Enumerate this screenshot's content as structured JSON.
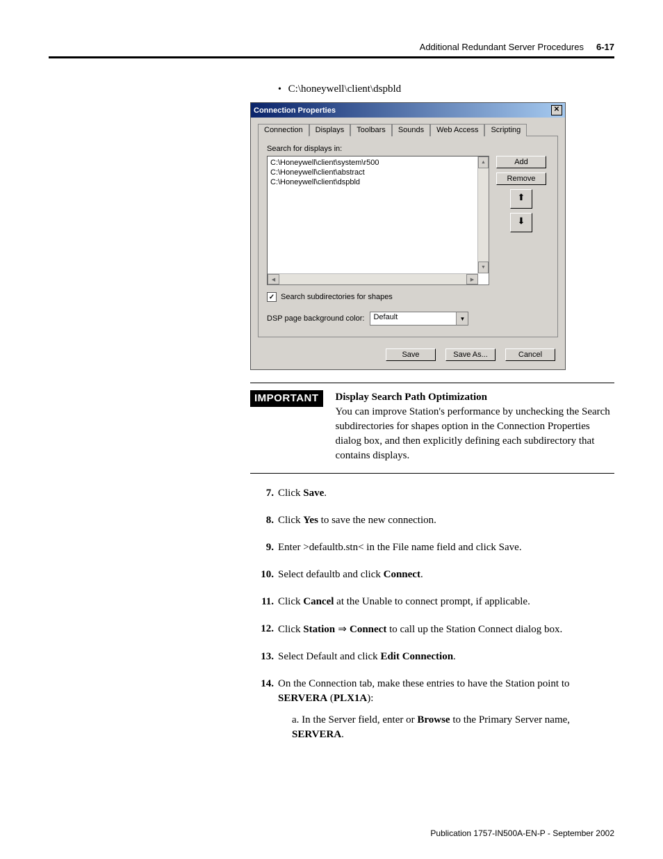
{
  "header": {
    "title": "Additional Redundant Server Procedures",
    "page_num": "6-17"
  },
  "bullet_path": "C:\\honeywell\\client\\dspbld",
  "dialog": {
    "title": "Connection Properties",
    "close_glyph": "✕",
    "tabs": [
      "Connection",
      "Displays",
      "Toolbars",
      "Sounds",
      "Web Access",
      "Scripting"
    ],
    "active_tab": 1,
    "search_label": "Search for displays in:",
    "paths": [
      "C:\\Honeywell\\client\\system\\r500",
      "C:\\Honeywell\\client\\abstract",
      "C:\\Honeywell\\client\\dspbld"
    ],
    "buttons": {
      "add": "Add",
      "remove": "Remove",
      "up": "⬆",
      "down": "⬇"
    },
    "checkbox_label": "Search subdirectories for shapes",
    "checkbox_checked": true,
    "bg_label": "DSP page background color:",
    "bg_value": "Default",
    "footer": {
      "save": "Save",
      "saveas": "Save As...",
      "cancel": "Cancel"
    }
  },
  "important": {
    "badge": "IMPORTANT",
    "title": "Display Search Path Optimization",
    "body": "You can improve Station's performance by unchecking the Search subdirectories for shapes option in the Connection Properties dialog box, and then explicitly defining each subdirectory that contains displays."
  },
  "steps": {
    "s7a": "Click ",
    "s7b": "Save",
    "s7c": ".",
    "s8a": "Click ",
    "s8b": "Yes",
    "s8c": " to save the new connection.",
    "s9": "Enter >defaultb.stn< in the File name field and click Save.",
    "s10a": "Select defaultb and click ",
    "s10b": "Connect",
    "s10c": ".",
    "s11a": "Click ",
    "s11b": "Cancel",
    "s11c": " at the Unable to connect prompt, if applicable.",
    "s12a": "Click ",
    "s12b": "Station",
    "s12c": " ⇒ ",
    "s12d": "Connect",
    "s12e": " to call up the Station Connect dialog box.",
    "s13a": "Select Default and click ",
    "s13b": "Edit Connection",
    "s13c": ".",
    "s14a": "On the Connection tab, make these entries to have the Station point to ",
    "s14b": "SERVERA",
    "s14c": " (",
    "s14d": "PLX1A",
    "s14e": "):",
    "s14sub_a": "In the Server field, enter or ",
    "s14sub_b": "Browse",
    "s14sub_c": " to the Primary Server name, ",
    "s14sub_d": "SERVERA",
    "s14sub_e": "."
  },
  "nums": {
    "n7": "7.",
    "n8": "8.",
    "n9": "9.",
    "n10": "10.",
    "n11": "11.",
    "n12": "12.",
    "n13": "13.",
    "n14": "14.",
    "sa": "a."
  },
  "footer_pub": "Publication 1757-IN500A-EN-P - September 2002"
}
